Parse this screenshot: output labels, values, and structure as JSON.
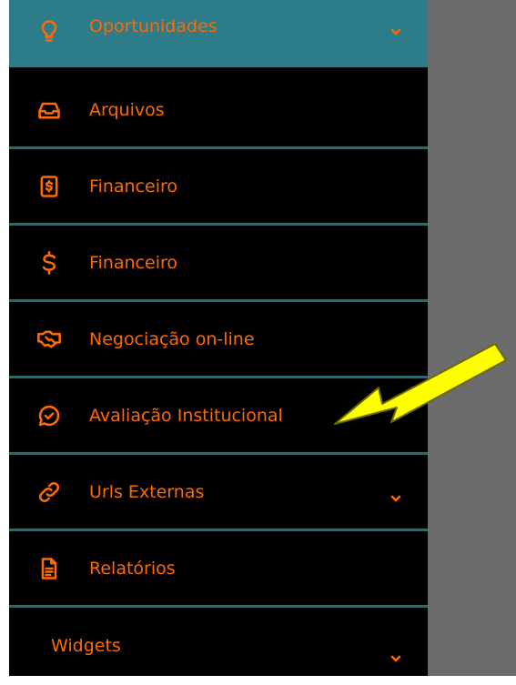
{
  "sidebar": {
    "items": [
      {
        "label": "Oportunidades",
        "icon": "lightbulb-icon",
        "has_chevron": true,
        "active": true
      },
      {
        "label": "Arquivos",
        "icon": "inbox-icon"
      },
      {
        "label": "Financeiro",
        "icon": "dollar-file-icon"
      },
      {
        "label": "Financeiro",
        "icon": "dollar-icon"
      },
      {
        "label": "Negociação on-line",
        "icon": "handshake-icon"
      },
      {
        "label": "Avaliação Institucional",
        "icon": "chat-check-icon"
      },
      {
        "label": "Urls Externas",
        "icon": "link-icon",
        "has_chevron": true
      },
      {
        "label": "Relatórios",
        "icon": "document-icon"
      },
      {
        "label": "Widgets",
        "has_chevron": true
      }
    ]
  },
  "colors": {
    "accent": "#ff6a00",
    "active_bg": "#2c7c8a",
    "divider": "#1a6f79",
    "sidebar_bg": "#000000",
    "annotation_arrow": "#ffff00"
  }
}
